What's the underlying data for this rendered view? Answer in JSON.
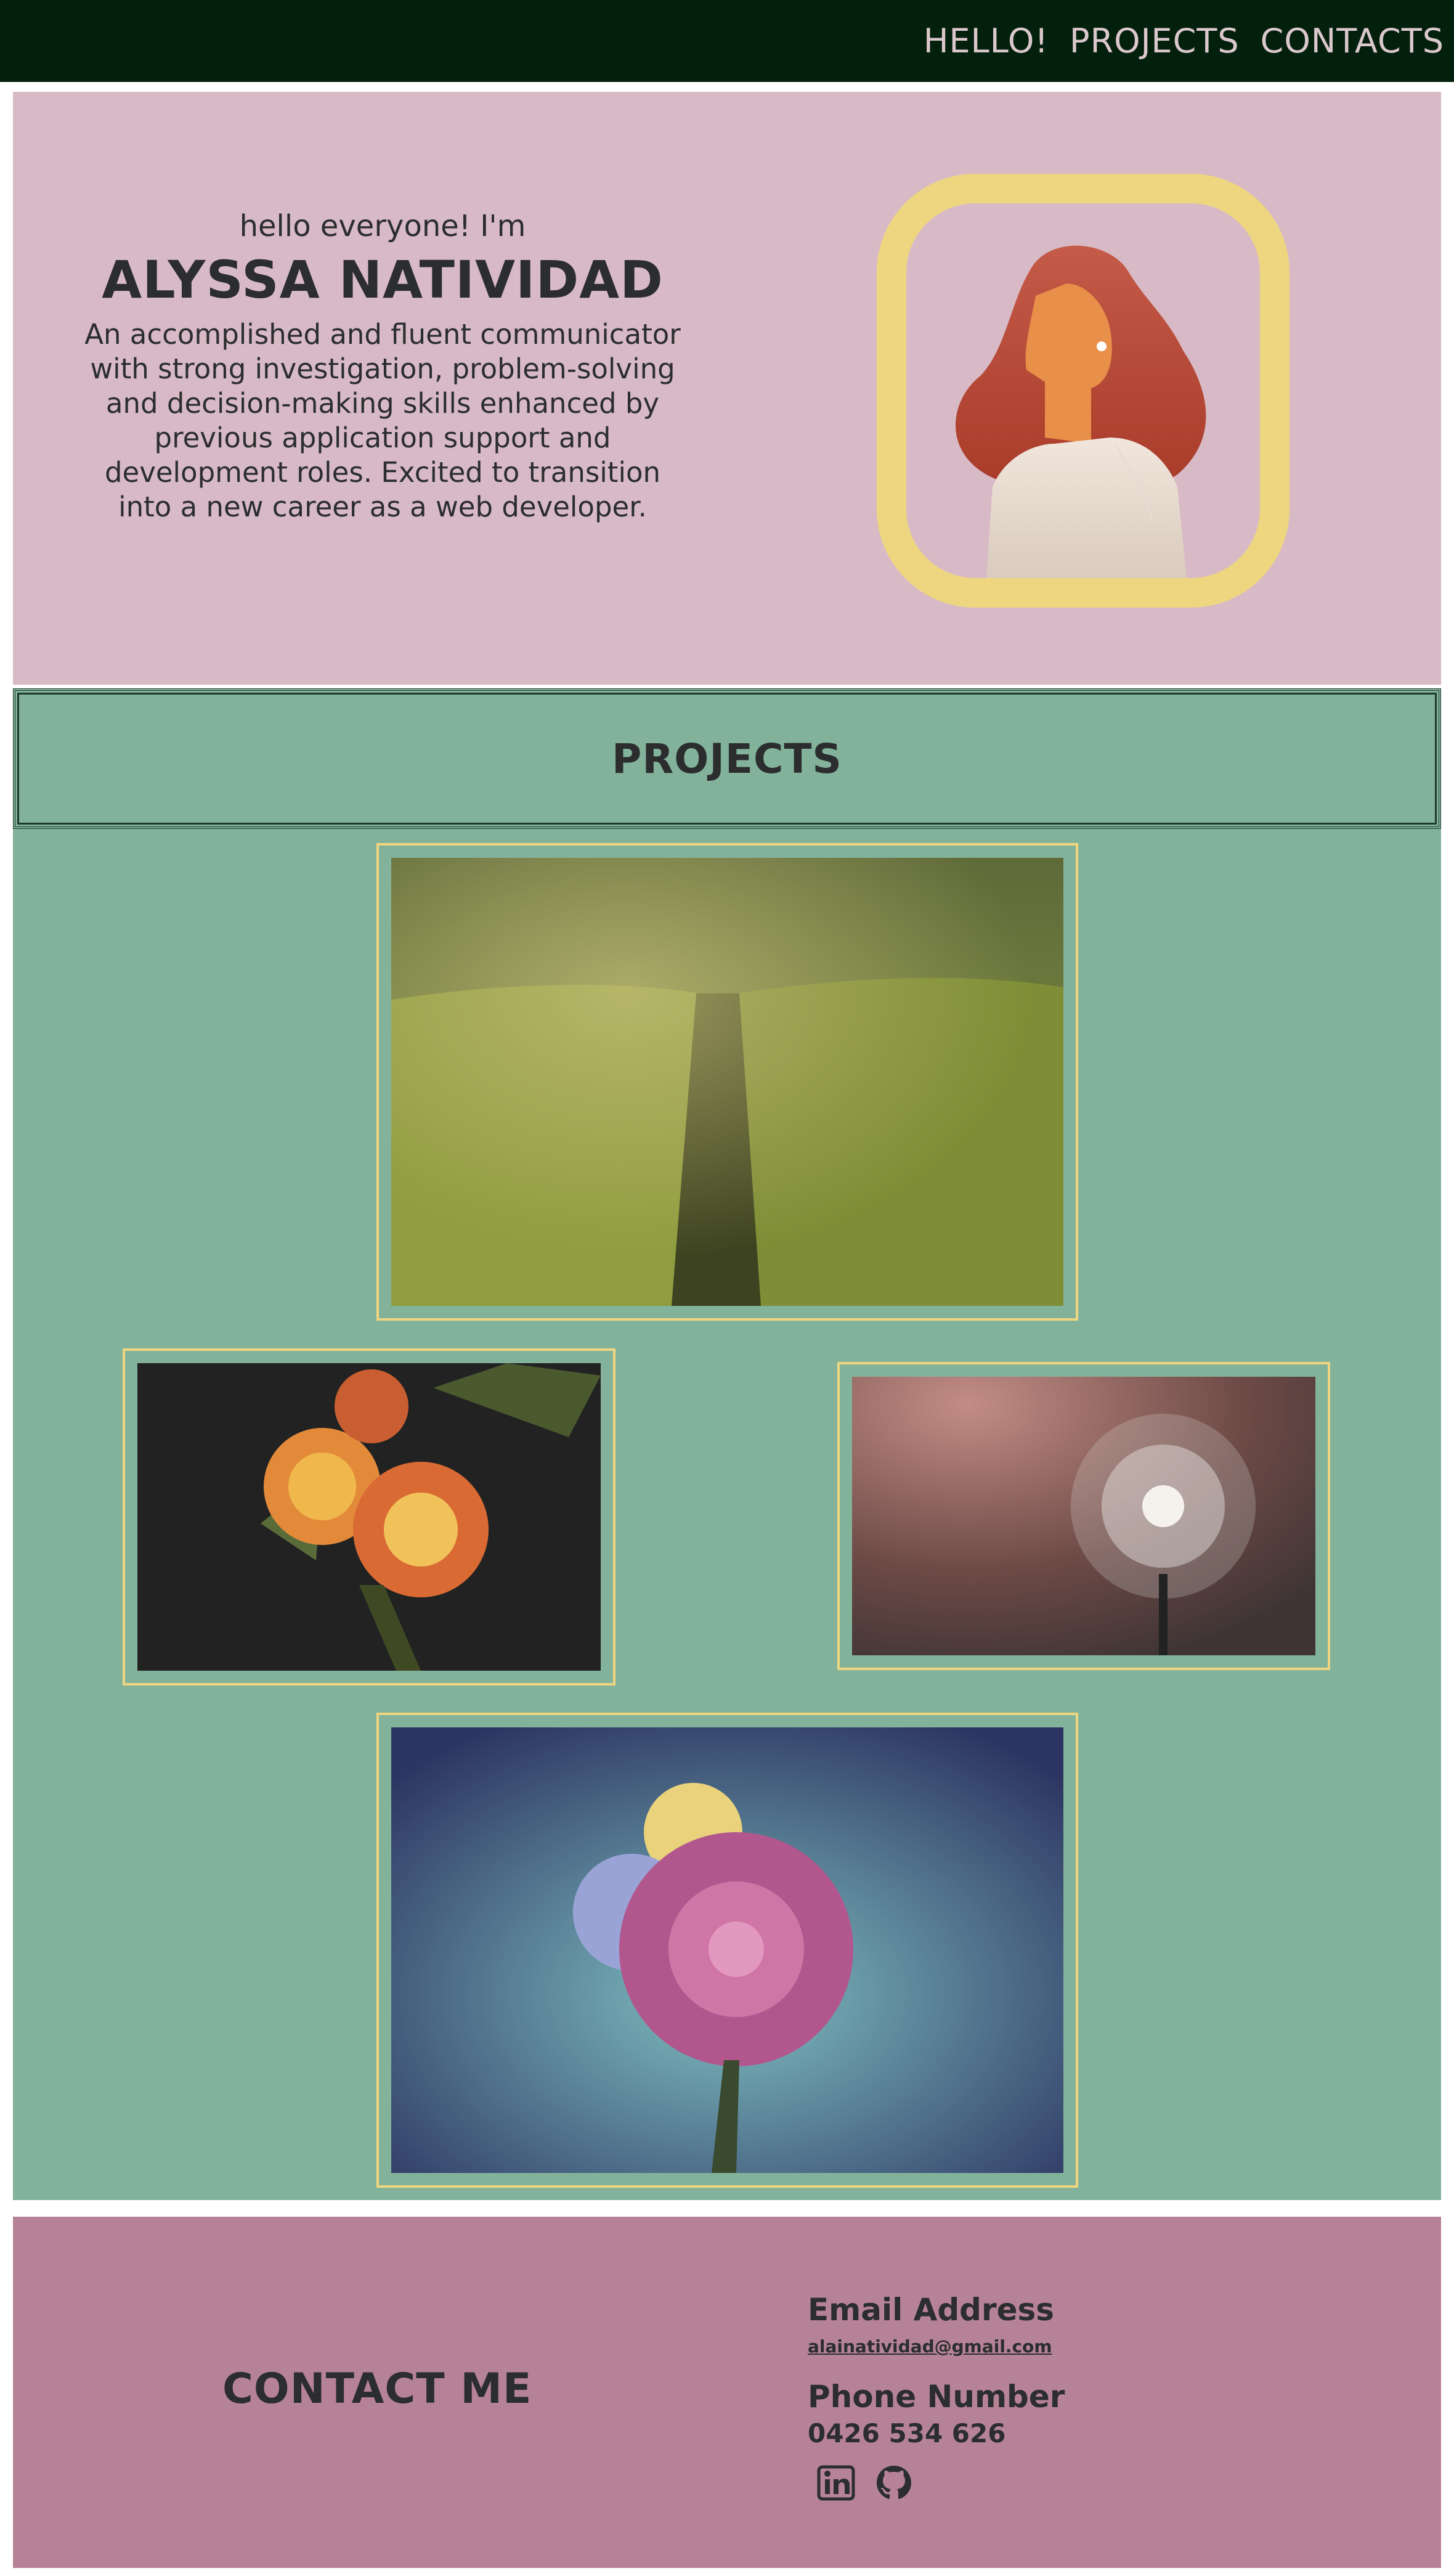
{
  "nav": {
    "items": [
      "HELLO!",
      "PROJECTS",
      "CONTACTS"
    ]
  },
  "hero": {
    "greeting": "hello everyone! I'm",
    "name": "ALYSSA NATIVIDAD",
    "bio": "An accomplished and fluent communicator with strong investigation, problem-solving and decision-making skills enhanced by previous application support and development roles. Excited to transition into a new career as a web developer."
  },
  "projects": {
    "title": "PROJECTS",
    "cards": [
      {
        "icon": "flower-field-image"
      },
      {
        "icon": "orange-roses-image"
      },
      {
        "icon": "dandelion-image"
      },
      {
        "icon": "rainbow-rose-image"
      }
    ]
  },
  "contact": {
    "title": "CONTACT ME",
    "email_label": "Email Address",
    "email": "alainatividad@gmail.com",
    "phone_label": "Phone Number",
    "phone": "0426 534 626",
    "icons": [
      "linkedin-icon",
      "github-icon"
    ]
  },
  "colors": {
    "topbar": "#03200c",
    "hero": "#d8bac6",
    "projects": "#82b29a",
    "contact": "#b68396",
    "frame": "#eed680",
    "text": "#2b2d2e"
  }
}
